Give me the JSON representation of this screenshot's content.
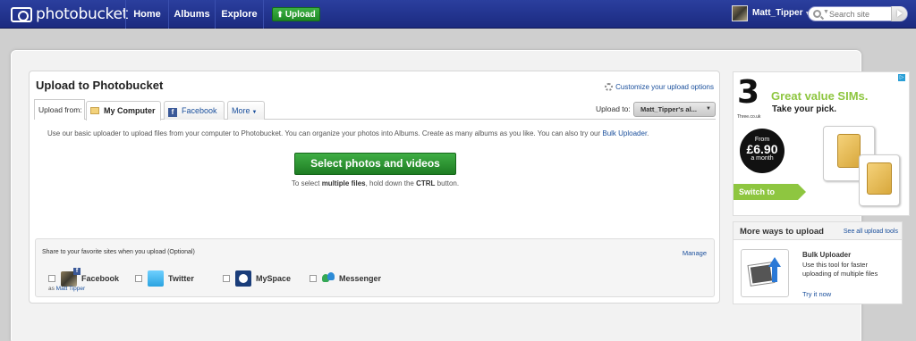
{
  "nav": {
    "logo_text": "photobucket",
    "items": [
      {
        "label": "Home"
      },
      {
        "label": "Albums"
      },
      {
        "label": "Explore"
      }
    ],
    "upload_label": "Upload",
    "user_name": "Matt_Tipper",
    "search_placeholder": "Search site"
  },
  "upload_panel": {
    "title": "Upload to Photobucket",
    "customize_link": "Customize your upload options",
    "upload_from_label": "Upload from:",
    "tabs": [
      {
        "label": "My Computer",
        "icon": "folder-icon",
        "active": true
      },
      {
        "label": "Facebook",
        "icon": "facebook-icon",
        "active": false
      },
      {
        "label": "More",
        "icon": "chevron-down-icon",
        "active": false
      }
    ],
    "upload_to_label": "Upload to:",
    "album_selected": "Matt_Tipper's al...",
    "intro_text": "Use our basic uploader to upload files from your computer to Photobucket. You can organize your photos into Albums. Create as many albums as you like. You can also try our ",
    "intro_link": "Bulk Uploader",
    "intro_end": ".",
    "select_button": "Select photos and videos",
    "hint_pre": "To select ",
    "hint_bold1": "multiple files",
    "hint_mid": ", hold down the ",
    "hint_bold2": "CTRL",
    "hint_post": " button."
  },
  "share": {
    "title": "Share to your favorite sites when you upload (Optional)",
    "manage_link": "Manage",
    "services": [
      {
        "label": "Facebook",
        "checked": false
      },
      {
        "label": "Twitter",
        "checked": false
      },
      {
        "label": "MySpace",
        "checked": false
      },
      {
        "label": "Messenger",
        "checked": false
      }
    ],
    "as_prefix": "as ",
    "as_user": "Matt Tipper"
  },
  "ad": {
    "logo": "3",
    "logo_sub": "Three.co.uk",
    "headline": "Great value SIMs.",
    "subline": "Take your pick.",
    "price_from": "From",
    "price_value": "£6.90",
    "price_period": "a month",
    "cta": "Switch to Three",
    "accent_color": "#8ec640"
  },
  "more_ways": {
    "title": "More ways to upload",
    "link": "See all upload tools",
    "tool_title": "Bulk Uploader",
    "tool_desc": "Use this tool for faster uploading of multiple files",
    "tool_link": "Try it now"
  },
  "colors": {
    "nav_bg": "#1b2a80",
    "link": "#1a4f9c",
    "upload_green": "#1f8a25"
  }
}
